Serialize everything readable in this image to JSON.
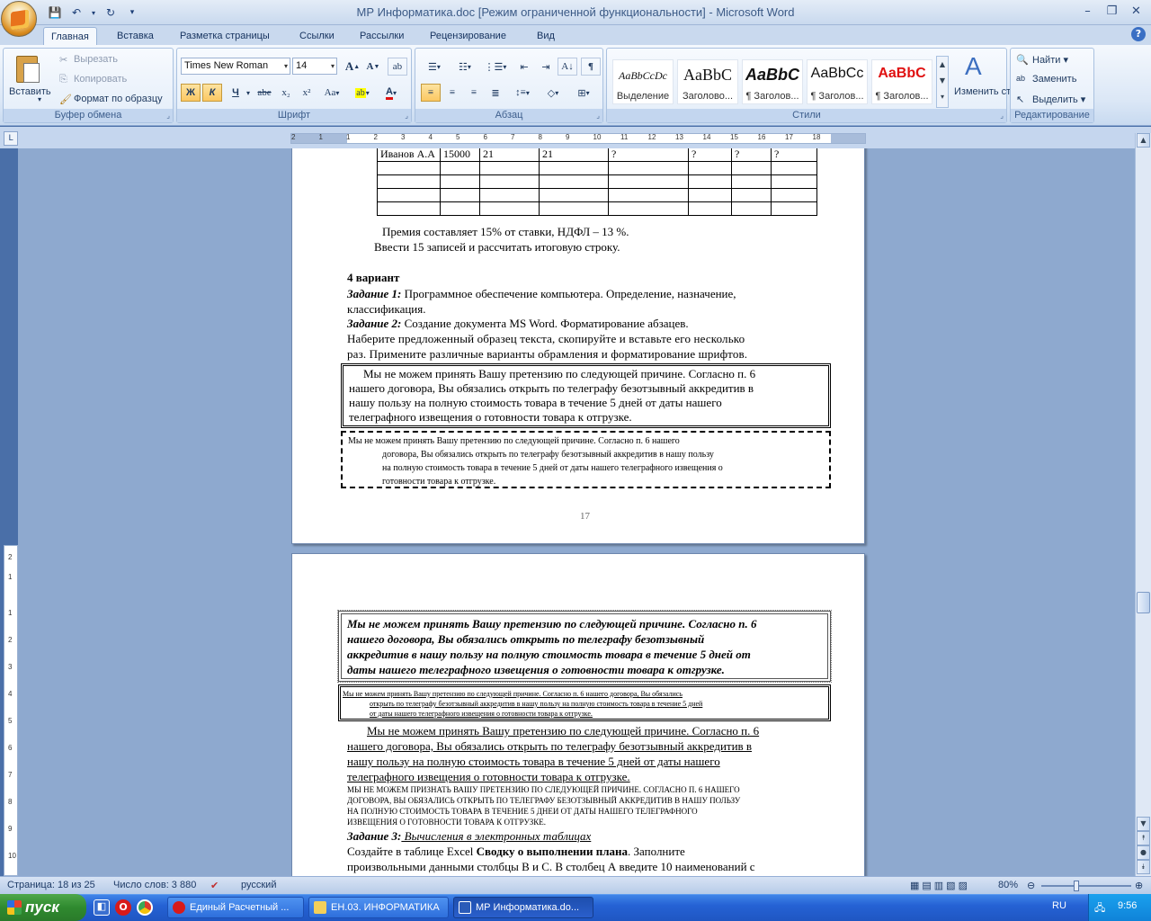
{
  "window": {
    "title": "МР Информатика.doc [Режим ограниченной функциональности] - Microsoft Word"
  },
  "tabs": [
    "Главная",
    "Вставка",
    "Разметка страницы",
    "Ссылки",
    "Рассылки",
    "Рецензирование",
    "Вид"
  ],
  "ribbon": {
    "clipboard": {
      "paste": "Вставить",
      "cut": "Вырезать",
      "copy": "Копировать",
      "format_painter": "Формат по образцу",
      "label": "Буфер обмена"
    },
    "font": {
      "name": "Times New Roman",
      "size": "14",
      "bold": "Ж",
      "italic": "К",
      "underline": "Ч",
      "strike": "abe",
      "sub": "x₂",
      "sup": "x²",
      "case": "Aa",
      "label": "Шрифт"
    },
    "paragraph": {
      "label": "Абзац"
    },
    "styles": {
      "label": "Стили",
      "items": [
        {
          "sample": "AaBbCcDc",
          "name": "Выделение"
        },
        {
          "sample": "AaBbC",
          "name": "Заголово..."
        },
        {
          "sample": "AaBbC",
          "name": "¶ Заголов..."
        },
        {
          "sample": "AaBbCc",
          "name": "¶ Заголов..."
        },
        {
          "sample": "AaBbC",
          "name": "¶ Заголов..."
        }
      ],
      "change": "Изменить стили"
    },
    "editing": {
      "find": "Найти",
      "replace": "Заменить",
      "select": "Выделить",
      "label": "Редактирование"
    }
  },
  "ruler": {
    "h_numbers": [
      "2",
      "1",
      "1",
      "2",
      "3",
      "4",
      "5",
      "6",
      "7",
      "8",
      "9",
      "10",
      "11",
      "12",
      "13",
      "14",
      "15",
      "16",
      "17",
      "18"
    ]
  },
  "page1": {
    "table": {
      "rows": [
        [
          "Иванов А.А",
          "15000",
          "21",
          "21",
          "?",
          "?",
          "?",
          "?"
        ],
        [
          "",
          "",
          "",
          "",
          "",
          "",
          "",
          ""
        ],
        [
          "",
          "",
          "",
          "",
          "",
          "",
          "",
          ""
        ],
        [
          "",
          "",
          "",
          "",
          "",
          "",
          "",
          ""
        ],
        [
          "",
          "",
          "",
          "",
          "",
          "",
          "",
          ""
        ]
      ]
    },
    "premium": "Премия составляет 15% от ставки, НДФЛ – 13 %.",
    "enter": "Ввести 15 записей  и рассчитать итоговую строку.",
    "variant": "4 вариант",
    "task1_label": "Задание 1:",
    "task1_text": " Программное обеспечение компьютера. Определение, назначение,",
    "task1_text2": "классификация.",
    "task2_label": "Задание 2:",
    "task2_text": " Создание документа MS Word.  Форматирование абзацев.",
    "instr1": "Наберите  предложенный  образец  текста,  скопируйте   и  вставьте   его  несколько",
    "instr2": "раз.  Примените  различные  варианты   обрамления   и  форматирование  шрифтов.",
    "box1": [
      "Мы не можем принять Вашу претензию по следующей причине.  Согласно п. 6",
      "нашего договора, Вы обязались открыть по телеграфу безотзывный аккредитив  в",
      "нашу пользу на полную стоимость товара в течение 5 дней от даты нашего",
      "телеграфного извещения о готовности товара к отгрузке."
    ],
    "box2": [
      "Мы не можем принять Вашу претензию по следующей причине.  Согласно п. 6 нашего",
      "договора, Вы обязались открыть по телеграфу безотзывный аккредитив  в нашу пользу",
      "на полную стоимость товара в течение 5 дней от даты нашего телеграфного извещения о",
      "готовности товара к отгрузке."
    ],
    "page_number": "17"
  },
  "page2": {
    "box3": [
      "Мы не можем принять Вашу претензию по следующей причине.  Согласно п. 6",
      "нашего договора, Вы обязались открыть по телеграфу безотзывный",
      "аккредитив  в нашу пользу на полную стоимость товара в течение 5 дней от",
      "даты нашего телеграфного извещения о готовности товара к отгрузке."
    ],
    "box4": [
      "Мы не можем принять Вашу претензию по следующей причине.  Согласно п. 6 нашего договора, Вы обязались",
      "открыть по телеграфу безотзывный аккредитив  в нашу пользу на полную стоимость товара в течение 5 дней",
      "от даты нашего телеграфного извещения о готовности товара к отгрузке."
    ],
    "para_ul": [
      "Мы не можем принять Вашу претензию по следующей причине.  Согласно п. 6",
      "нашего договора, Вы обязались открыть по телеграфу безотзывный аккредитив  в",
      "нашу пользу на полную стоимость товара в течение 5 дней от даты нашего",
      "телеграфного извещения о готовности товара к отгрузке."
    ],
    "caps": [
      "МЫ НЕ МОЖЕМ ПРИЗНАТЬ ВАШУ ПРЕТЕНЗИЮ ПО СЛЕДУЮЩЕЙ ПРИЧИНЕ. СОГЛАСНО П. 6 НАШЕГО",
      "ДОГОВОРА, ВЫ ОБЯЗАЛИСЬ ОТКРЫТЬ ПО ТЕЛЕГРАФУ БЕЗОТЗЫВНЫЙ АККРЕДИТИВ В НАШУ ПОЛЬЗУ",
      "НА  ПОЛНУЮ  СТОИМОСТЬ  ТОВАРА  В  ТЕЧЕНИЕ  5  ДНЕИ  ОТ  ДАТЫ  НАШЕГО  ТЕЛЕГРАФНОГО",
      "ИЗВЕЩЕНИЯ О ГОТОВНОСТИ ТОВАРА К  ОТГРУЗКЕ."
    ],
    "task3_label": "Задание 3:",
    "task3_text": " Вычисления в  электронных таблицах",
    "last1a": " Создайте   в    таблице  Excel    ",
    "last1b": "Сводку    о  выполнении  плана",
    "last1c": ".  Заполните",
    "last2": "произвольными данными столбцы В и С. В столбец А введите 10 наименований с"
  },
  "status": {
    "page": "Страница: 18 из 25",
    "words": "Число слов: 3 880",
    "lang": "русский",
    "zoom": "80%"
  },
  "taskbar": {
    "start": "пуск",
    "tasks": [
      "Единый Расчетный ...",
      "ЕН.03. ИНФОРМАТИКА",
      "МР Информатика.do..."
    ],
    "lang": "RU",
    "time": "9:56"
  }
}
